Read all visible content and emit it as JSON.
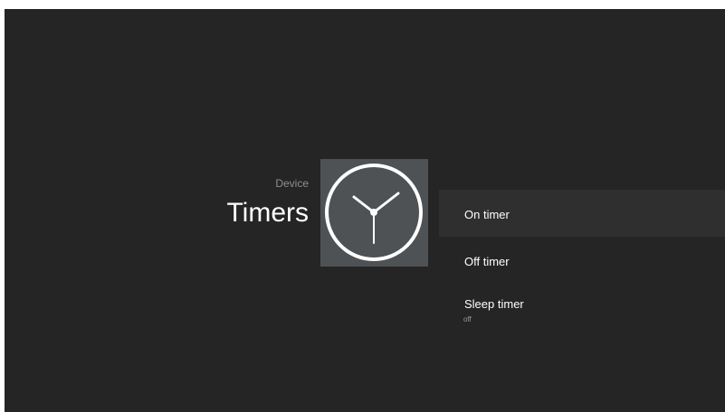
{
  "header": {
    "category": "Device",
    "title": "Timers"
  },
  "icon": {
    "name": "clock-icon"
  },
  "menu": {
    "items": [
      {
        "label": "On timer",
        "selected": true
      },
      {
        "label": "Off timer",
        "selected": false
      },
      {
        "label": "Sleep timer",
        "sub": "off",
        "selected": false
      }
    ]
  },
  "colors": {
    "background": "#262526",
    "tile": "#4e5254",
    "selected_row": "#2f2f30",
    "text": "#ffffff",
    "muted_text": "#8f8f8f"
  }
}
